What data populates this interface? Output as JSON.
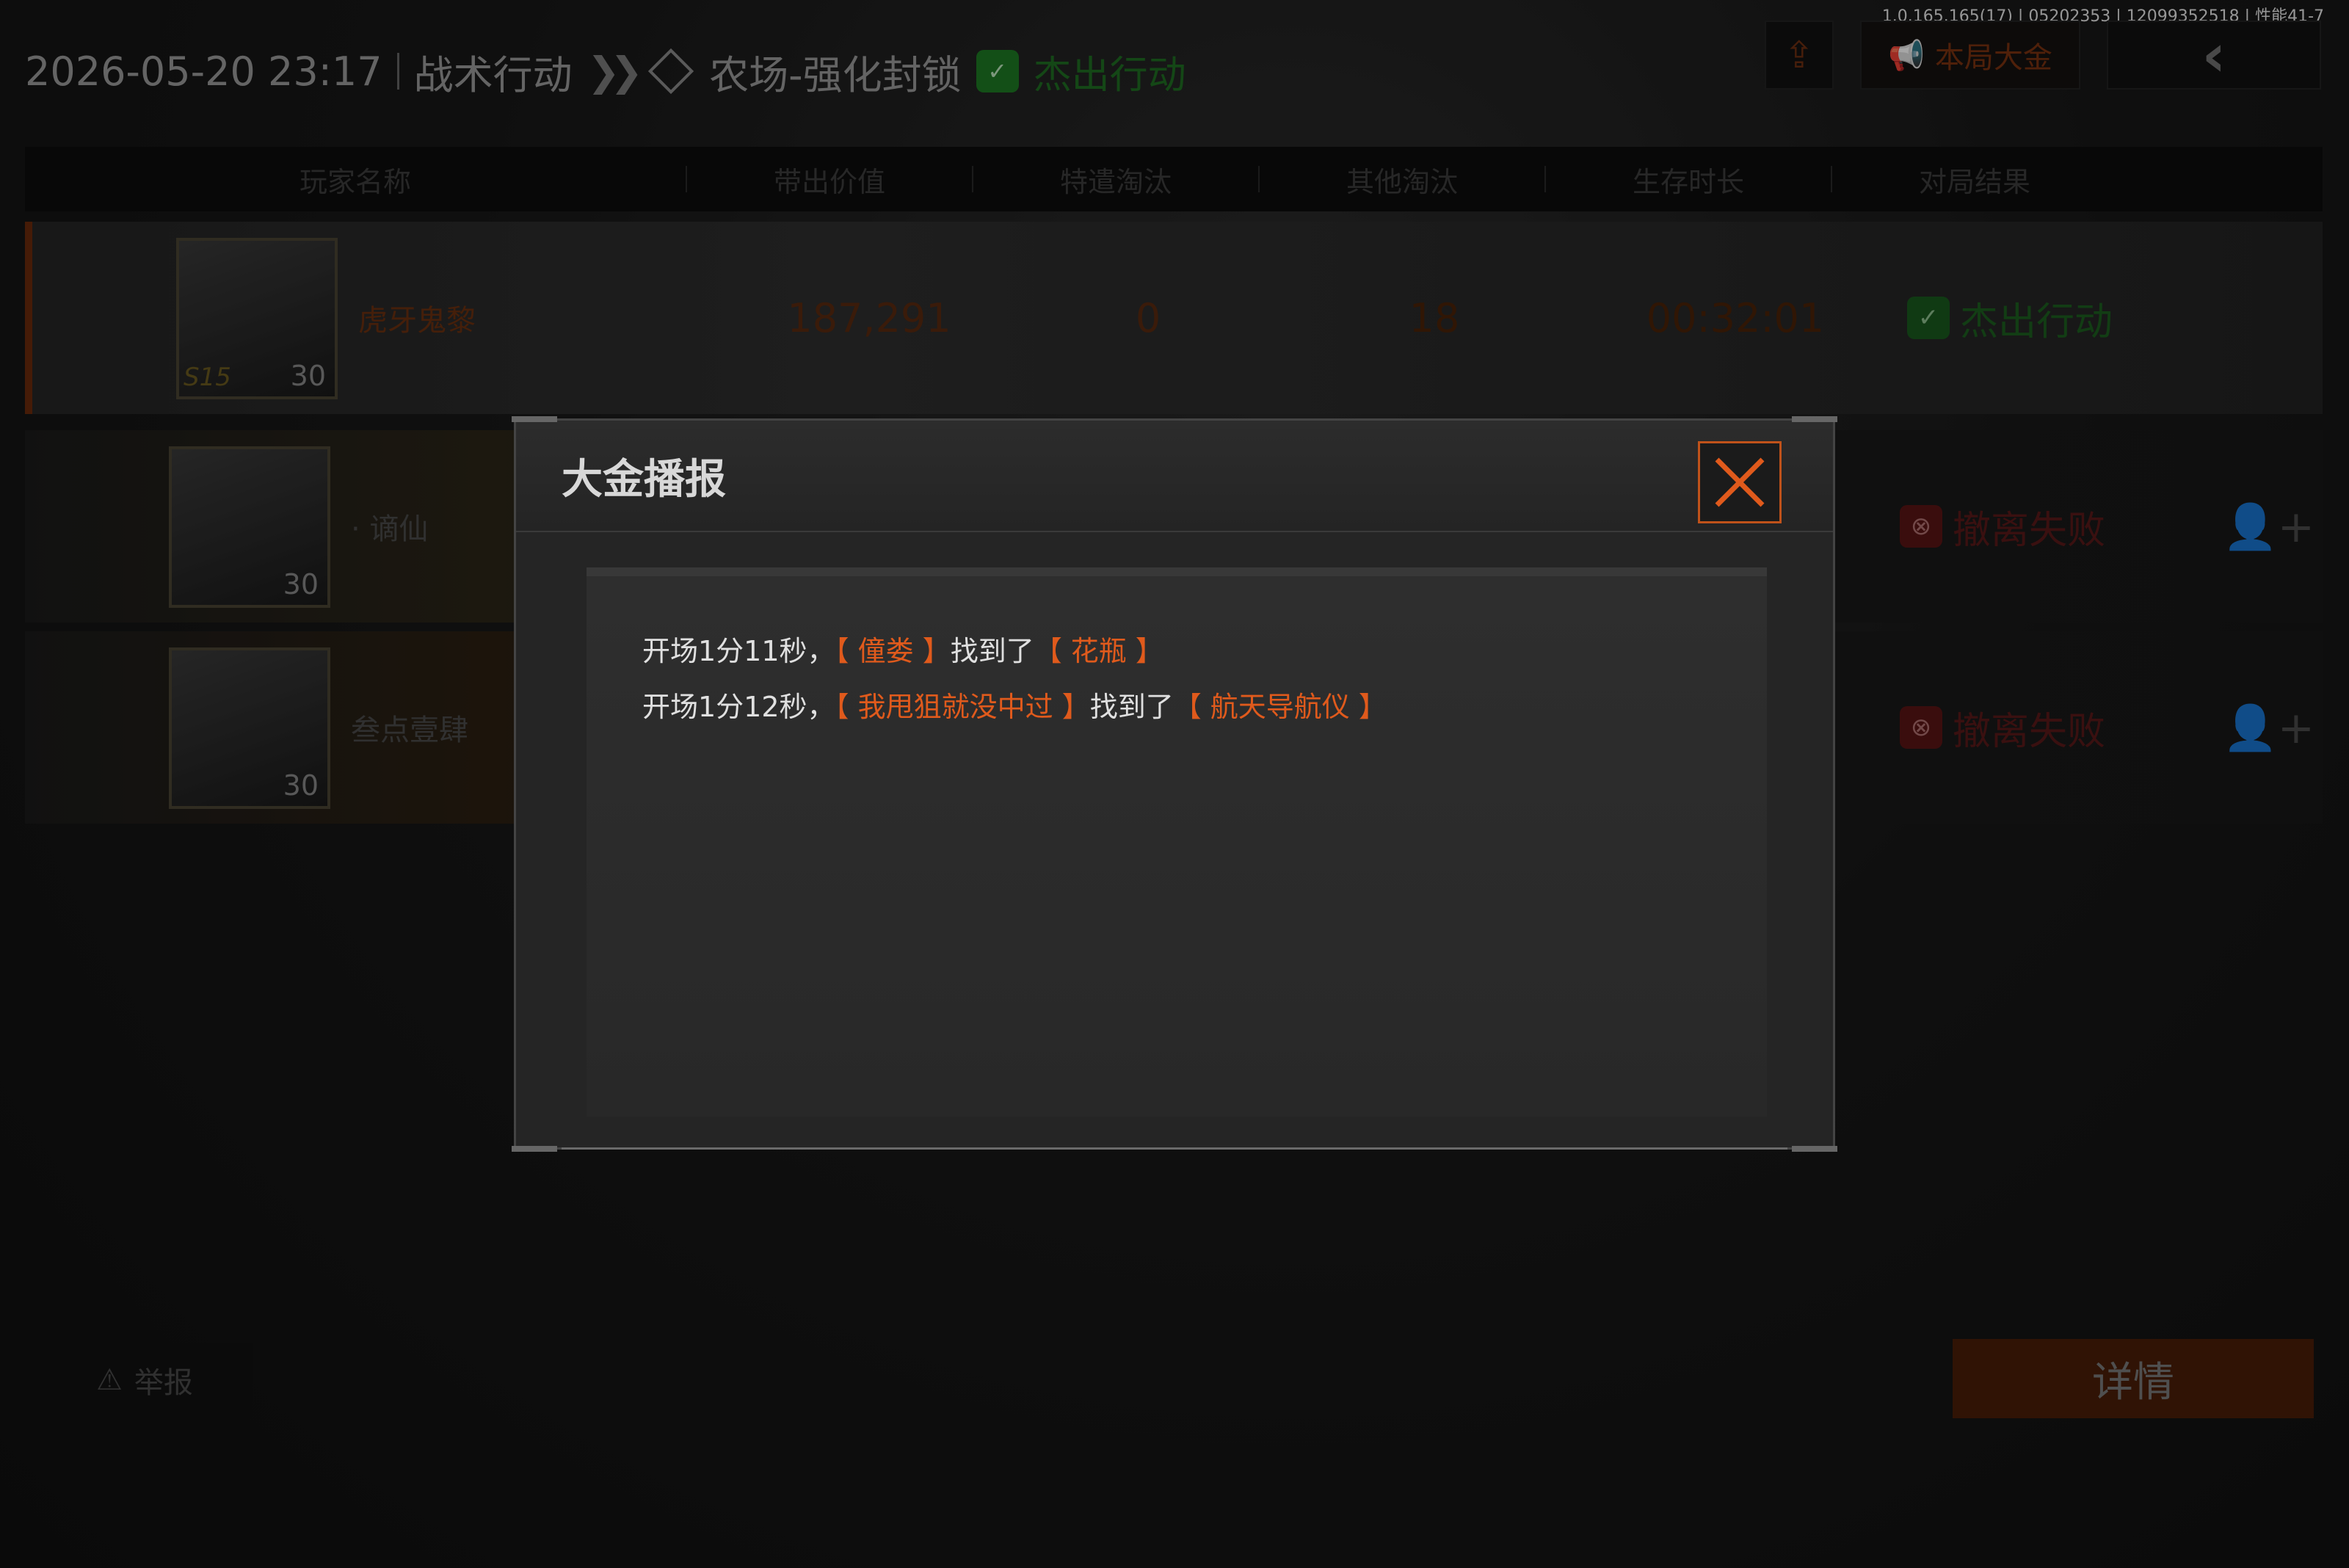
{
  "version_info": "1.0.165.165(17) | 05202353 | 12099352518 | 性能41-7",
  "header": {
    "datetime": "2026-05-20 23:17",
    "mode": "战术行动",
    "map": "农场-强化封锁",
    "result": "杰出行动"
  },
  "top_buttons": {
    "big_money_label": "本局大金"
  },
  "columns": [
    "玩家名称",
    "带出价值",
    "特遣淘汰",
    "其他淘汰",
    "生存时长",
    "对局结果"
  ],
  "players": [
    {
      "name": "虎牙鬼黎",
      "level": "30",
      "tag": "S15",
      "value": "187,291",
      "kills_special": "0",
      "kills_other": "18",
      "survival": "00:32:01",
      "result": "杰出行动"
    },
    {
      "name": "· 谪仙",
      "level": "30",
      "tag": "",
      "value": "",
      "kills_special": "",
      "kills_other": "",
      "survival": "",
      "result": "撤离失败"
    },
    {
      "name": "叁点壹肆",
      "level": "30",
      "tag": "",
      "value": "",
      "kills_special": "",
      "kills_other": "",
      "survival": "",
      "result": "撤离失败"
    }
  ],
  "footer": {
    "report_label": "举报",
    "details_label": "详情"
  },
  "modal": {
    "title": "大金播报",
    "messages": [
      {
        "prefix": "开场1分11秒，",
        "player": "【 僮娄 】",
        "mid": "找到了",
        "item": "【 花瓶 】"
      },
      {
        "prefix": "开场1分12秒，",
        "player": "【 我甩狙就没中过 】",
        "mid": "找到了",
        "item": "【 航天导航仪 】"
      }
    ]
  },
  "colors": {
    "accent": "#e05a1c",
    "success": "#1e7a24",
    "fail": "#8a1a1a"
  }
}
